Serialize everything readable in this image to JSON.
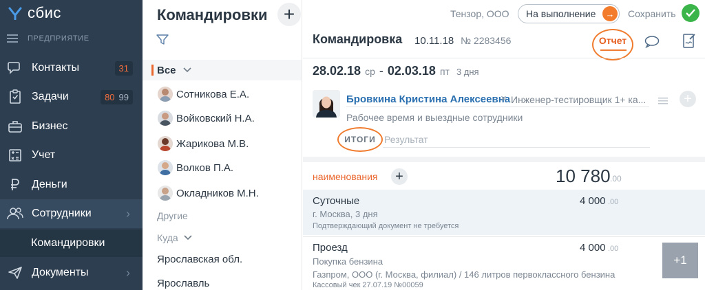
{
  "app": {
    "logo_text": "сбис",
    "org_section": "ПРЕДПРИЯТИЕ"
  },
  "nav": {
    "items": [
      {
        "label": "Контакты",
        "count_red": "31"
      },
      {
        "label": "Задачи",
        "count_red": "80",
        "count_gray": "99"
      },
      {
        "label": "Бизнес"
      },
      {
        "label": "Учет"
      },
      {
        "label": "Деньги"
      },
      {
        "label": "Сотрудники",
        "chevron": "›"
      },
      {
        "label": "Документы",
        "chevron": "›"
      }
    ],
    "sub_item": "Командировки"
  },
  "list": {
    "title": "Командировки",
    "add_symbol": "+",
    "group_all": "Все",
    "employees": [
      "Сотникова Е.А.",
      "Войковский Н.А.",
      "Жарикова М.В.",
      "Волков П.А.",
      "Окладников М.Н."
    ],
    "other_label": "Другие",
    "where_label": "Куда",
    "destinations": [
      "Ярославская обл.",
      "Ярославль"
    ]
  },
  "panel": {
    "org_name": "Тензор, ООО",
    "exec_button": "На выполнение",
    "exec_arrow": "→",
    "save_label": "Сохранить",
    "doc_title": "Командировка",
    "doc_date": "10.11.18",
    "doc_number": "№ 2283456",
    "tab_report": "Отчет",
    "date_from": "28.02.18",
    "weekday_from": "ср",
    "date_dash": "-",
    "date_to": "02.03.18",
    "weekday_to": "пт",
    "days": "3 дня",
    "employee_name": "Бровкина Кристина Алексеевна",
    "remove_symbol": "×",
    "employee_post": "Инженер-тестировщик 1+ ка...",
    "work_time": "Рабочее время и выездные сотрудники",
    "itogi": "ИТОГИ",
    "result_placeholder": "Результат",
    "names_label": "наименования",
    "total_int": "10 780",
    "total_dec": ".00",
    "rows": [
      {
        "title": "Суточные",
        "sub": "г. Москва, 3 дня",
        "note": "Подтверждающий документ не требуется",
        "amount": "4 000",
        "amount_dec": ".00"
      },
      {
        "title": "Проезд",
        "sub": "Покупка бензина",
        "sub2": "Газпром, ООО (г. Москва, филиал) / 146 литров первоклассного бензина",
        "note": "Кассовый чек 27.07.19  №00059",
        "amount": "4 000",
        "amount_dec": ".00",
        "attach": "+1"
      }
    ]
  },
  "colors": {
    "nav_bg": "#2d3e50",
    "accent_orange": "#f07c2f",
    "ok_green": "#3bb54a",
    "link_blue": "#2a6fb0"
  }
}
